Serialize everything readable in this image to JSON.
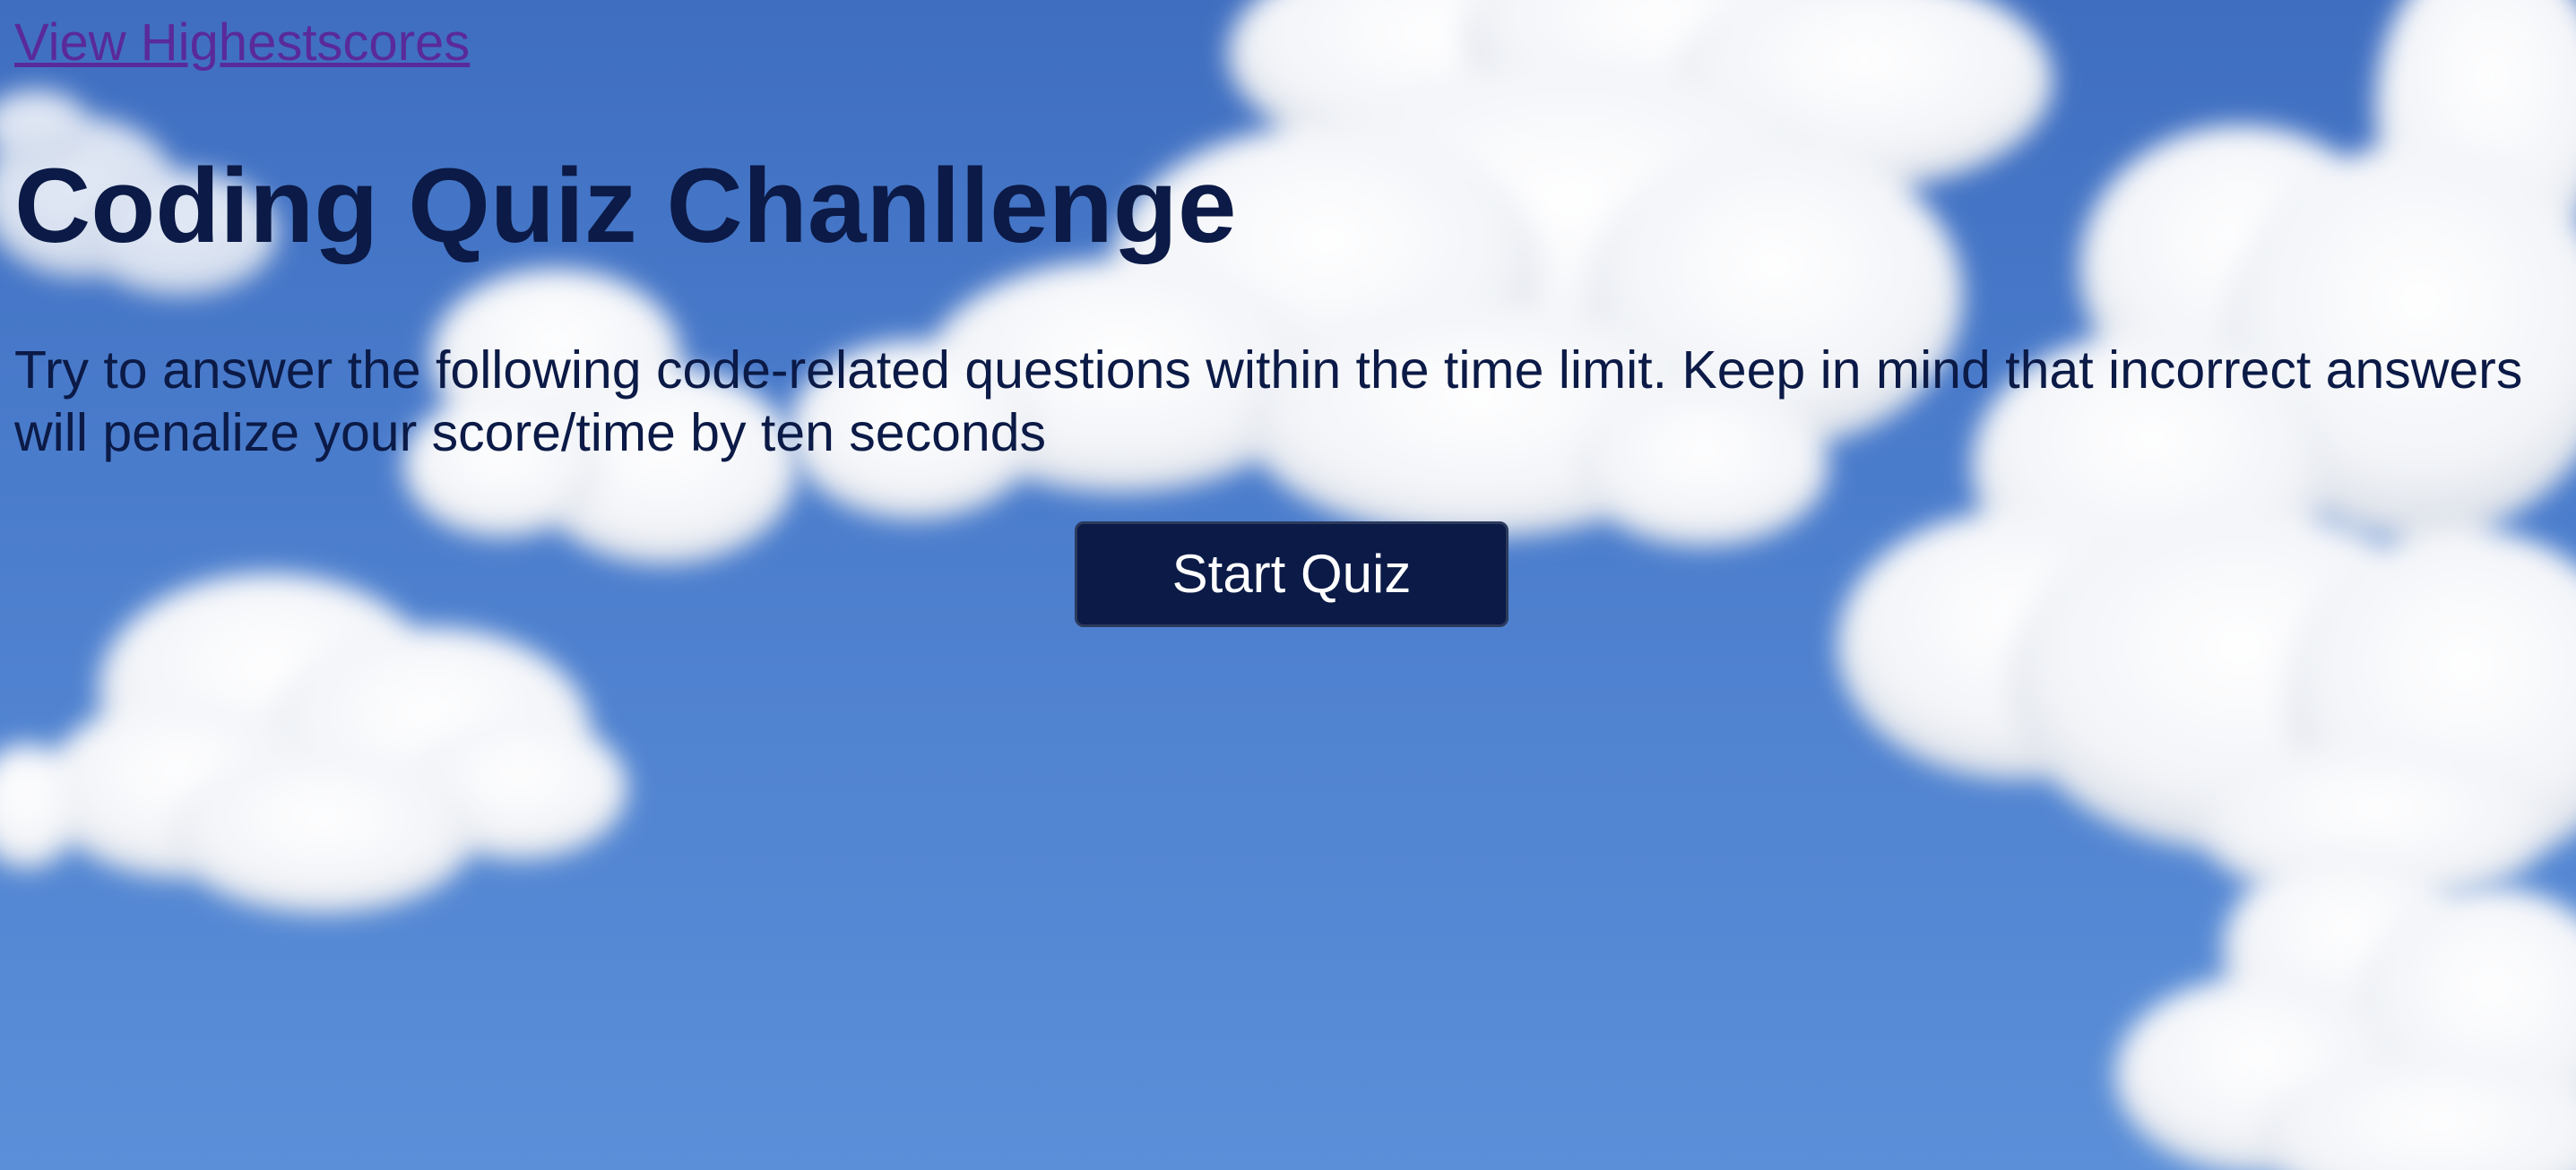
{
  "nav": {
    "highscores_label": "View Highestscores"
  },
  "main": {
    "title": "Coding Quiz Chanllenge",
    "instructions": "Try to answer the following code-related questions within the time limit. Keep in mind that incorrect answers will penalize your score/time by ten seconds",
    "start_label": "Start Quiz"
  },
  "colors": {
    "sky": "#4a7ccc",
    "title_text": "#0b1a46",
    "link": "#5a2a9a",
    "button_bg": "#0b1a46",
    "button_text": "#ffffff"
  }
}
